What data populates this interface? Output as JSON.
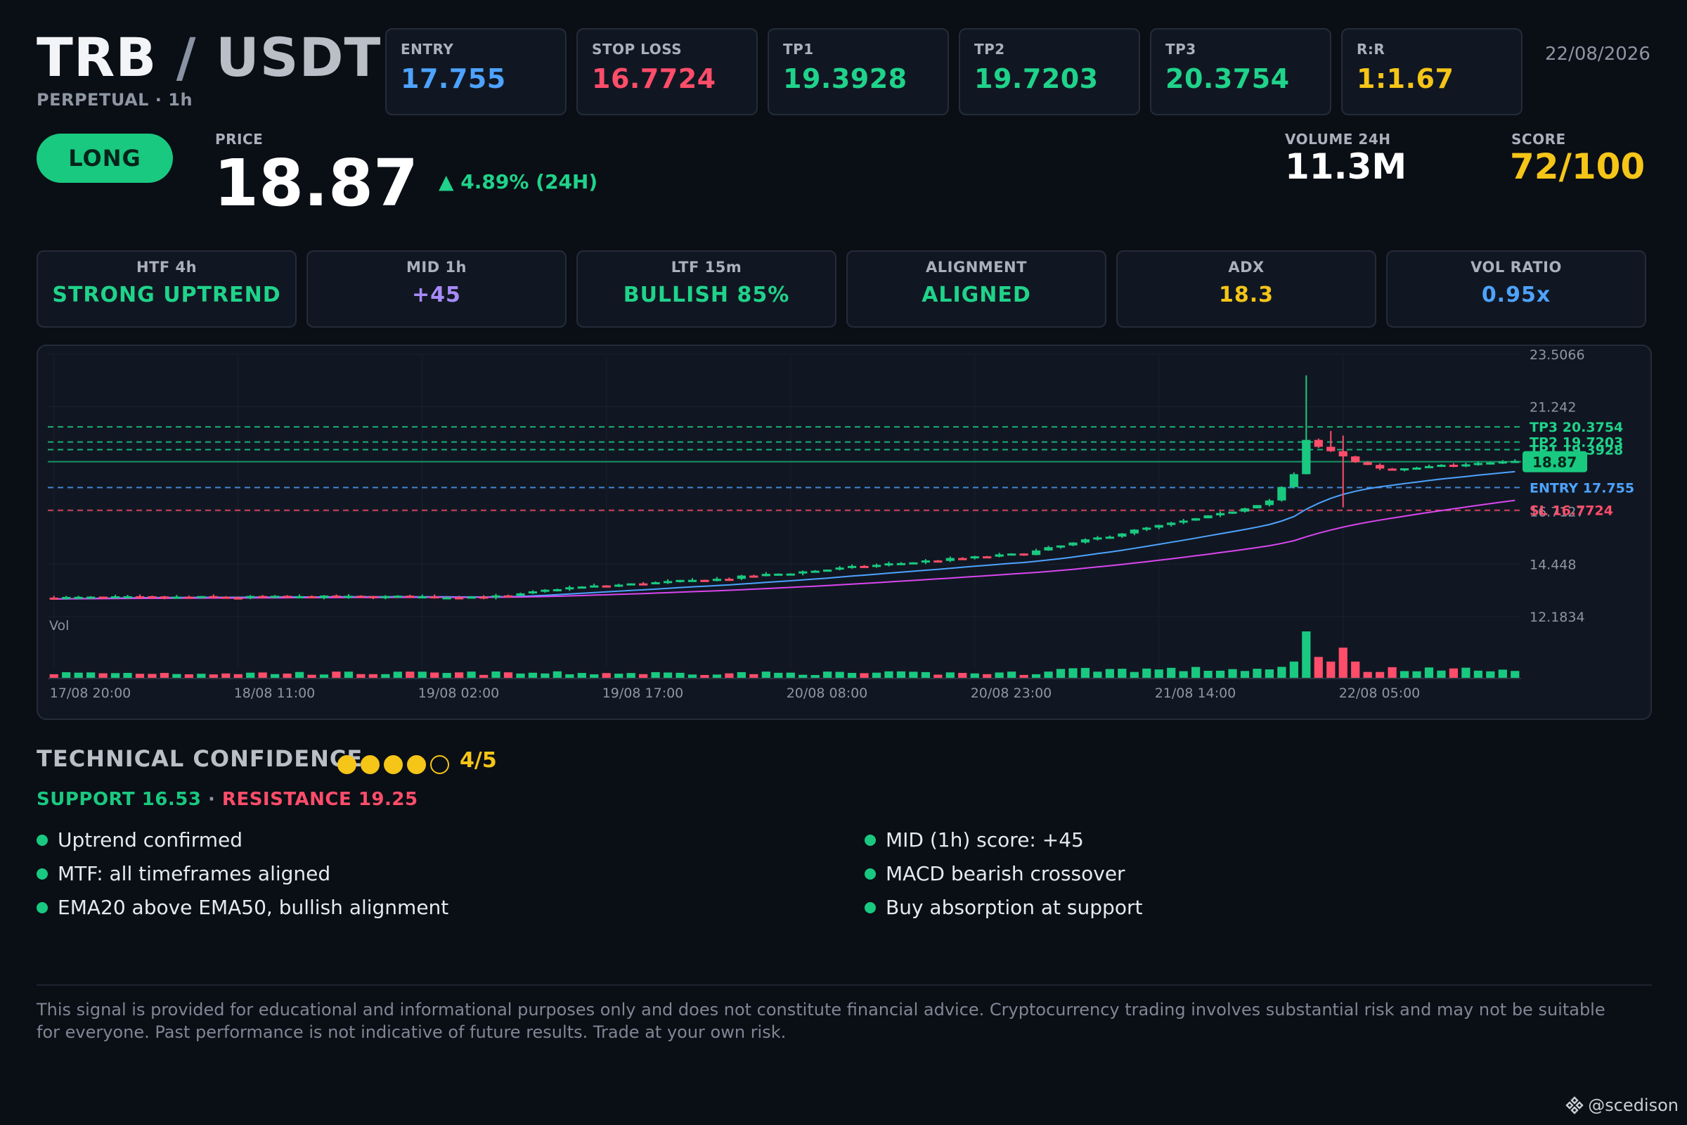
{
  "header": {
    "base": "TRB",
    "slash": "/",
    "quote": "USDT",
    "subtitle": "PERPETUAL · 1h",
    "date": "22/08/2026"
  },
  "levels": [
    {
      "label": "ENTRY",
      "value": "17.755",
      "color": "#4da3ff"
    },
    {
      "label": "STOP LOSS",
      "value": "16.7724",
      "color": "#ff4d6a"
    },
    {
      "label": "TP1",
      "value": "19.3928",
      "color": "#1fd38a"
    },
    {
      "label": "TP2",
      "value": "19.7203",
      "color": "#1fd38a"
    },
    {
      "label": "TP3",
      "value": "20.3754",
      "color": "#1fd38a"
    },
    {
      "label": "R:R",
      "value": "1:1.67",
      "color": "#f5c518"
    }
  ],
  "signal": {
    "direction": "LONG",
    "price_label": "PRICE",
    "price": "18.87",
    "change": "▲ 4.89% (24H)",
    "volume_label": "VOLUME 24H",
    "volume": "11.3M",
    "score_label": "SCORE",
    "score": "72/100"
  },
  "timeframes": [
    {
      "label": "HTF 4h",
      "value": "STRONG UPTREND",
      "color": "#1fd38a"
    },
    {
      "label": "MID 1h",
      "value": "+45",
      "color": "#a78bfa"
    },
    {
      "label": "LTF 15m",
      "value": "BULLISH 85%",
      "color": "#1fd38a"
    },
    {
      "label": "ALIGNMENT",
      "value": "ALIGNED",
      "color": "#1fd38a"
    },
    {
      "label": "ADX",
      "value": "18.3",
      "color": "#f5c518"
    },
    {
      "label": "VOL RATIO",
      "value": "0.95x",
      "color": "#4da3ff"
    }
  ],
  "chart_data": {
    "type": "candlestick",
    "ylim": [
      9.9,
      23.5066
    ],
    "y_ticks": [
      "23.5066",
      "21.242",
      "16.7127",
      "14.448",
      "12.1834"
    ],
    "y_tick_values": [
      23.5066,
      21.242,
      16.7127,
      14.448,
      12.1834
    ],
    "x_ticks": [
      "17/08 20:00",
      "18/08 11:00",
      "19/08 02:00",
      "19/08 17:00",
      "20/08 08:00",
      "20/08 23:00",
      "21/08 14:00",
      "22/08 05:00"
    ],
    "x_tick_index": [
      0,
      15,
      30,
      45,
      60,
      75,
      90,
      105
    ],
    "volume_label": "Vol",
    "current_price_label": "18.87",
    "current_price": 18.87,
    "levels": [
      {
        "label": "TP3 20.3754",
        "value": 20.3754,
        "color": "#1fd38a"
      },
      {
        "label": "TP2 19.7203",
        "value": 19.7203,
        "color": "#1fd38a"
      },
      {
        "label": "TP1 19.3928",
        "value": 19.3928,
        "color": "#1fd38a"
      },
      {
        "label": "ENTRY 17.755",
        "value": 17.755,
        "color": "#4da3ff"
      },
      {
        "label": "SL 16.7724",
        "value": 16.7724,
        "color": "#ff4d6a"
      }
    ],
    "ema_colors": {
      "ema20": "#4da3ff",
      "ema50": "#d946ef"
    }
  },
  "confidence": {
    "title": "TECHNICAL CONFIDENCE",
    "filled": 4,
    "total": 5,
    "score": "4/5",
    "support": "SUPPORT 16.53",
    "separator": " · ",
    "resistance": "RESISTANCE 19.25"
  },
  "factors_left": [
    "Uptrend confirmed",
    "MTF: all timeframes aligned",
    "EMA20 above EMA50, bullish alignment"
  ],
  "factors_right": [
    "MID (1h) score: +45",
    "MACD bearish crossover",
    "Buy absorption at support"
  ],
  "disclaimer": "This signal is provided for educational and informational purposes only and does not constitute financial advice. Cryptocurrency trading involves substantial risk and may not be suitable for everyone. Past performance is not indicative of future results. Trade at your own risk.",
  "watermark": "@scedison",
  "colors": {
    "green": "#19c980",
    "red": "#ff4d6a",
    "blue": "#4da3ff",
    "yellow": "#f5c518",
    "purple": "#a78bfa"
  }
}
